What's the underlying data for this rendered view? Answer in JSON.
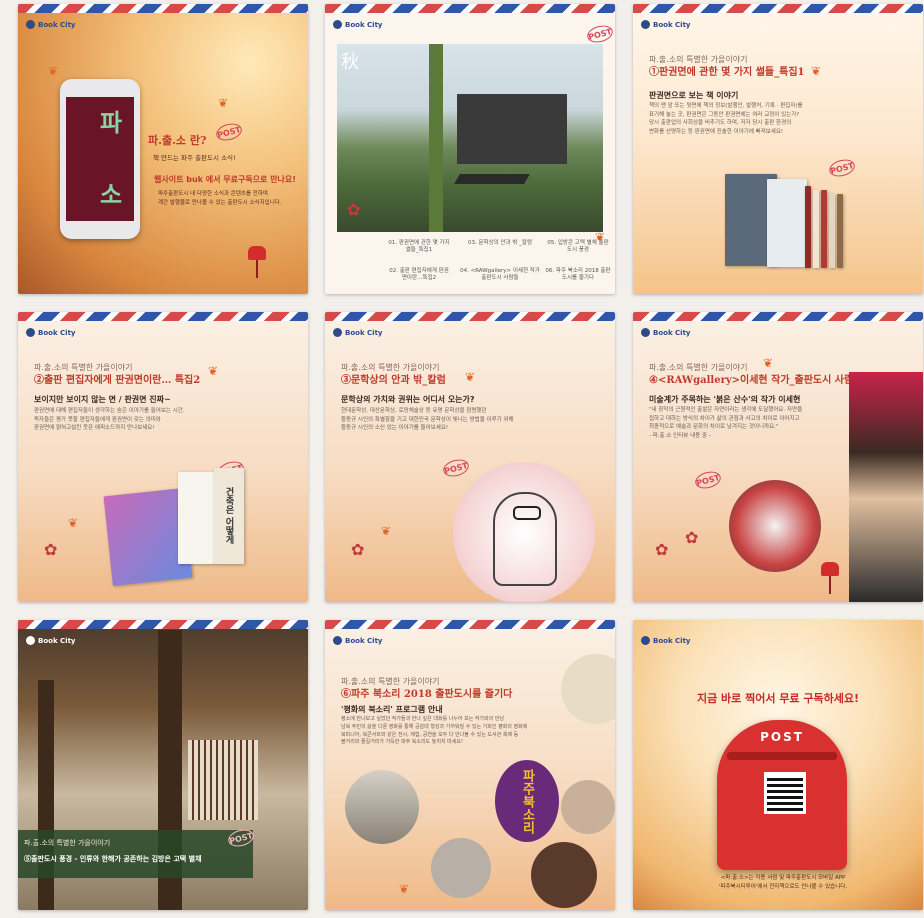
{
  "brand": {
    "logo_text": "Book City"
  },
  "cards": {
    "c1": {
      "post_stamp": "POST",
      "question": "파.출.소 란?",
      "tagline": "책 만드는 파주 출판도시 소식!",
      "headline": "웹사이트 buk 에서 무료구독으로 만나요!",
      "description": "파주출판도시 내 다양한 소식과 콘텐츠를 전하며\n계간 발행물로 만나볼 수 있는 출판도시 소식지입니다.",
      "phone_text_1": "파",
      "phone_text_2": "소"
    },
    "c2": {
      "post_stamp": "POST",
      "photo_label": "秋",
      "menu": [
        "01. 판권면에 관한\n몇 가지 썰들_특집1",
        "03. 문학상의 안과 밖\n_칼럼",
        "05. 입방콘 고택 별채\n출판도시 풍경",
        "02. 출판 편집자에게\n판권면이란…특집2",
        "04. <RAWgallery> 이세현 작가\n출판도시 사람들",
        "06. 파주 북소리 2018\n출판도시를 즐기다"
      ]
    },
    "c3": {
      "subtitle": "파.출.소의 특별한 가을이야기",
      "title": "①판권면에 관한 몇 가지 썰들_특집1",
      "heading": "판권면으로 보는 책 이야기",
      "body": "책의 맨 앞 또는 뒷면에 책의 정보(발행인, 발행처, 기록 · 편집자)를\n표기해 놓는 곳, 판권면은 그동안 판권면에는 여러 교정이 있는가?\n당시 출판업의 사회상을 비추기도 하며, 저자 당시 출판 환경의\n변화를 선명하는 등 판권면에 진솔한 이야기에 빠져보세요!",
      "post_stamp": "POST"
    },
    "c4": {
      "subtitle": "파.출.소의 특별한 가을이야기",
      "title": "②출판 편집자에게 판권면이란… 특집2",
      "heading": "보이지만 보이지 않는 면 / 판권면 진짜~",
      "body": "판권면에 대해 편집자들이 생각하는 숨은 이야기를 들어보는 시간.\n독자들은 평가 못할 편집자들에게 판권면이 갖는 의미와\n판권면에 얽혀고설킨 웃픈 에피소드까지 만나보세요!",
      "post_stamp": "POST",
      "book_text": "건축은 어떻게"
    },
    "c5": {
      "subtitle": "파.출.소의 특별한 가을이야기",
      "title": "③문학상의 안과 밖_칼럼",
      "heading": "문학상의 가치와 권위는 어디서 오는가?",
      "body": "현대문학상, 대산문학상, 로망채술상 등 유명 문학상을 점령했던\n황동규 시인의 특별함을 기고 대한민국 문학상이 빛나는 방법을 이루기 위해\n황동규 시인의 소신 있는 이야기를 들어보세요!",
      "post_stamp": "POST"
    },
    "c6": {
      "subtitle": "파.출.소의 특별한 가을이야기",
      "title": "④<RAWgallery>이세현 작가_출판도시 사람들",
      "heading": "미술계가 주목하는 '붉은 산수'의 작가 이세현",
      "body": "\"내 창작의 근원적인 출발은 자연이라는 생각에 도달했어요. 자연을\n접하고 대하는 방식의 차이가 삶의 관점과 사고의 차이로 이어지고\n최종적으로 예술과 문화의 차이로 남겨지는 것이니까요.\"\n- 파.출.소 인터뷰 내용 중 -",
      "post_stamp": "POST"
    },
    "c7": {
      "subtitle": "파.출.소의 특별한 가을이야기",
      "title": "⑤출판도시 풍경 - 인류와 한해가 공존하는 김방은 고택 별채",
      "post_stamp": "POST"
    },
    "c8": {
      "subtitle": "파.출.소의 특별한 가을이야기",
      "title": "⑥파주 북소리 2018 출판도시를 즐기다",
      "heading": "'평화의 북소리' 프로그램 안내",
      "body": "평소에 만나보고 싶었던 작가들과 만나 깊은 대화를 나누어 보는 작가와의 만남\n남북 주민의 삶을 다룬 영화를 통해 공감대 형성과 가까워질 수 있는 기회인 평화의 영화제\n북피니어, 북콘서트와 같은 전시, 체험, 공연을 모두 다 만나볼 수 있는 도서관 축제 등\n볼거리와 즐길거리가 가득한 파주 북소리도 놓치지 마세요!",
      "poster_text": "파주북소리"
    },
    "c9": {
      "headline": "지금 바로 찍어서 무료 구독하세요!",
      "box_label": "POST",
      "footer": "<파.출.소>는 각종 서점 및 파주출판도시 모바일 APP\n'파주북시티투어'에서 전자책으로도 만나볼 수 있습니다."
    }
  },
  "colors": {
    "accent_red": "#c03a2a",
    "stamp_pink": "#d4455e",
    "brand_blue": "#2d4a8a"
  }
}
